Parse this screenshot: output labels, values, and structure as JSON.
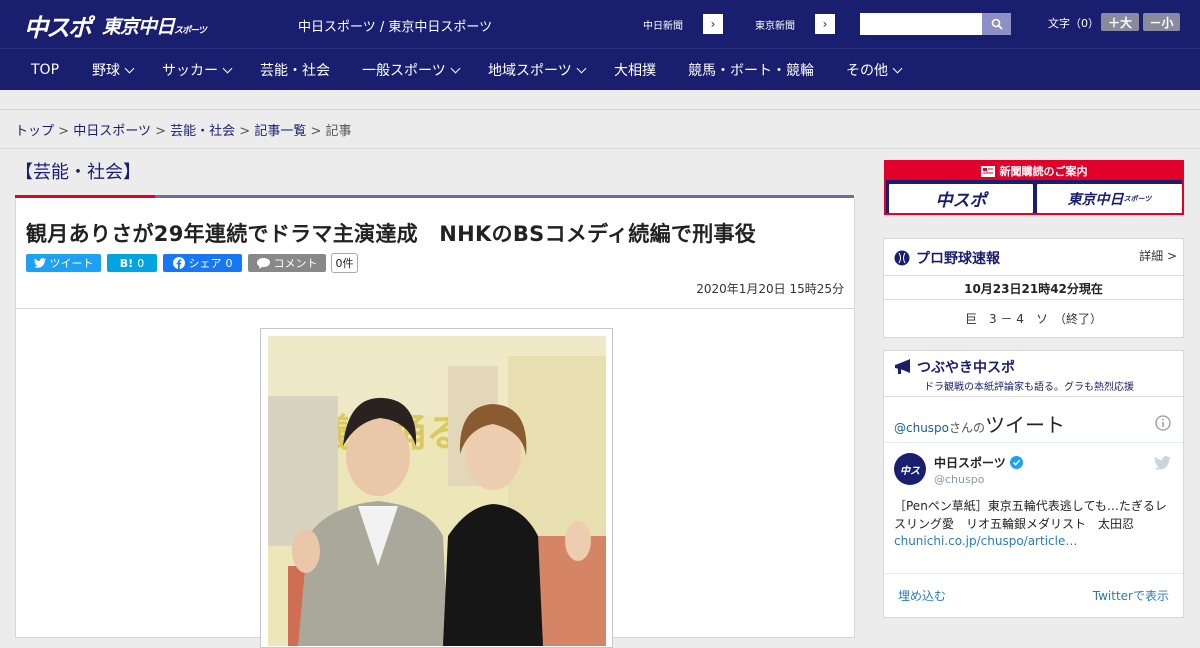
{
  "header": {
    "logo_chuspo": "中スポ",
    "logo_tokyo": "東京中日",
    "logo_tokyo_sub": "スポーツ",
    "site_title": "中日スポーツ / 東京中日スポーツ",
    "paper_links": [
      "中日新聞",
      "東京新聞"
    ],
    "search_placeholder": "",
    "font_size_label": "文字（0）",
    "font_larger": "＋大",
    "font_smaller": "－小"
  },
  "nav": {
    "items": [
      {
        "label": "TOP",
        "has_menu": false
      },
      {
        "label": "野球",
        "has_menu": true
      },
      {
        "label": "サッカー",
        "has_menu": true
      },
      {
        "label": "芸能・社会",
        "has_menu": false
      },
      {
        "label": "一般スポーツ",
        "has_menu": true
      },
      {
        "label": "地域スポーツ",
        "has_menu": true
      },
      {
        "label": "大相撲",
        "has_menu": false
      },
      {
        "label": "競馬・ボート・競輪",
        "has_menu": false
      },
      {
        "label": "その他",
        "has_menu": true
      }
    ]
  },
  "breadcrumb": {
    "items": [
      "トップ",
      "中日スポーツ",
      "芸能・社会",
      "記事一覧"
    ],
    "current": "記事",
    "separator": ">"
  },
  "article": {
    "category": "【芸能・社会】",
    "headline": "観月ありさが29年連続でドラマ主演達成　NHKのBSコメディ続編で刑事役",
    "share": {
      "tweet": "ツイート",
      "hatena": "B!",
      "hatena_count": "0",
      "facebook": "シェア",
      "facebook_count": "0",
      "comment": "コメント",
      "comment_count": "0件"
    },
    "date": "2020年1月20日 15時25分",
    "photo_poster_text": "会議は踊る"
  },
  "sidebar": {
    "subscribe_title": "新聞購読のご案内",
    "subscribe_buttons": [
      "中スポ",
      "東京中日"
    ],
    "subscribe_button_sub": "スポーツ",
    "baseball": {
      "title": "プロ野球速報",
      "detail": "詳細 >",
      "updated": "10月23日21時42分現在",
      "score": "巨　3 － 4　ソ　（終了）"
    },
    "tsubuyaki": {
      "title": "つぶやき中スポ",
      "subtitle": "ドラ観戦の本紙評論家も語る。グラも熱烈応援",
      "account_prefix": "@chuspo",
      "account_suffix": "さんの",
      "tweets_label": "ツイート",
      "tweet": {
        "name": "中日スポーツ",
        "handle": "@chuspo",
        "text": "［Penペン草紙］東京五輪代表逃しても…たぎるレスリング愛　リオ五輪銀メダリスト　太田忍",
        "link": "chunichi.co.jp/chuspo/article…"
      },
      "embed": "埋め込む",
      "view_on_twitter": "Twitterで表示"
    }
  },
  "colors": {
    "navy": "#1a1e6e",
    "red": "#e0002a",
    "twitter": "#1da1f2",
    "hatena": "#00a4de",
    "facebook": "#1877f2"
  }
}
